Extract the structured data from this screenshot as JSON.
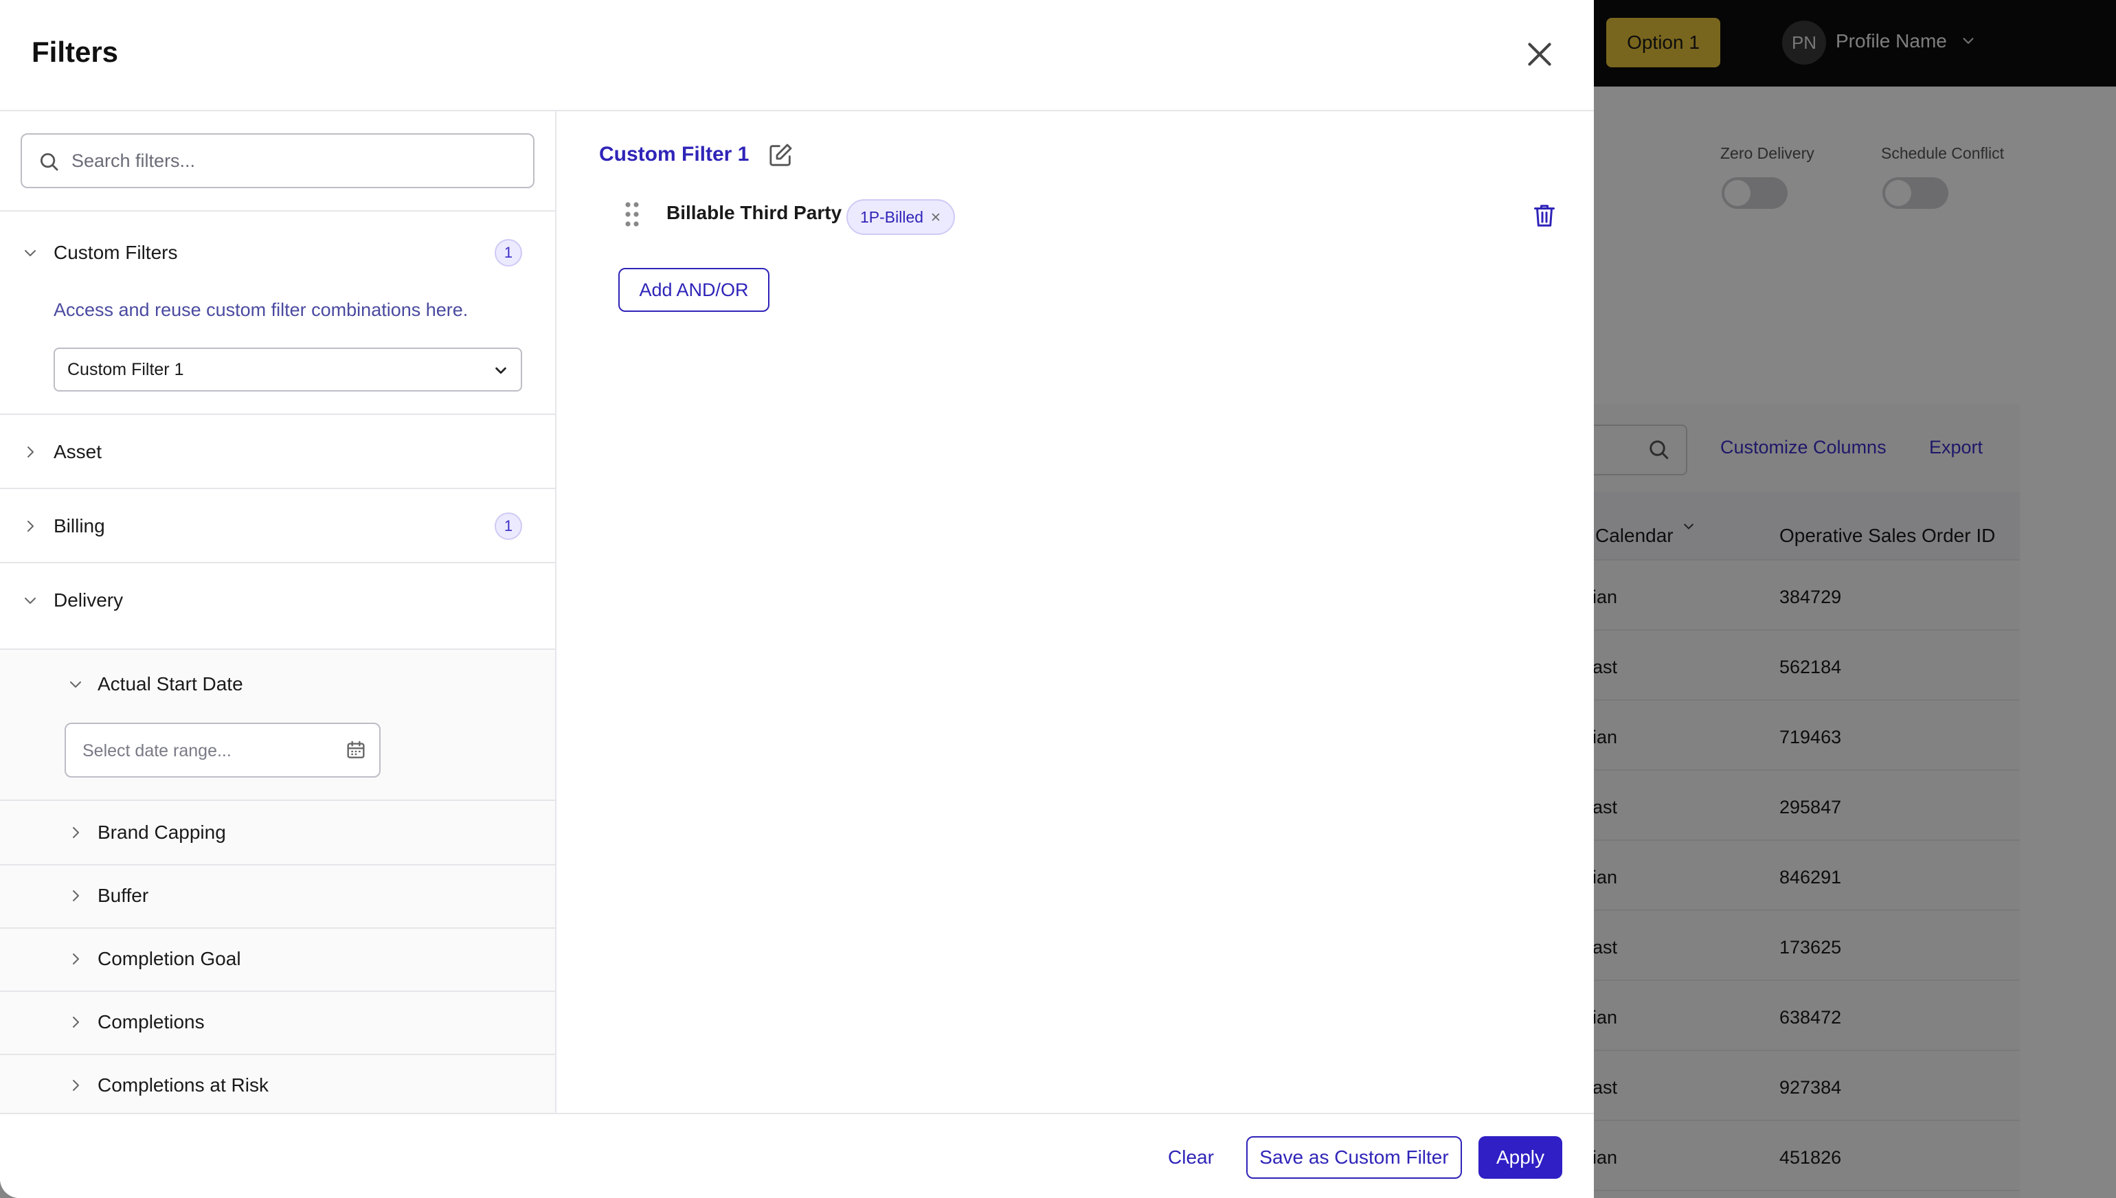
{
  "background": {
    "topbar": {
      "option_label": "Option 1",
      "avatar_initials": "PN",
      "profile_name": "Profile Name"
    },
    "toggles": [
      {
        "label": "Zero Delivery"
      },
      {
        "label": "Schedule Conflict"
      }
    ],
    "toolbar": {
      "customize_columns": "Customize Columns",
      "export": "Export"
    },
    "table": {
      "headers": [
        "Calendar",
        "Operative Sales Order ID"
      ],
      "rows": [
        {
          "calendar": "ian",
          "order_id": "384729"
        },
        {
          "calendar": "ast",
          "order_id": "562184"
        },
        {
          "calendar": "ian",
          "order_id": "719463"
        },
        {
          "calendar": "ast",
          "order_id": "295847"
        },
        {
          "calendar": "ian",
          "order_id": "846291"
        },
        {
          "calendar": "ast",
          "order_id": "173625"
        },
        {
          "calendar": "ian",
          "order_id": "638472"
        },
        {
          "calendar": "ast",
          "order_id": "927384"
        },
        {
          "calendar": "ian",
          "order_id": "451826"
        }
      ]
    }
  },
  "modal": {
    "title": "Filters",
    "search": {
      "placeholder": "Search filters..."
    },
    "sections": {
      "custom_filters": {
        "label": "Custom Filters",
        "count": "1",
        "helper": "Access and reuse custom filter combinations here.",
        "selected": "Custom Filter 1"
      },
      "asset": {
        "label": "Asset"
      },
      "billing": {
        "label": "Billing",
        "count": "1"
      },
      "delivery": {
        "label": "Delivery",
        "actual_start_date": {
          "label": "Actual Start Date",
          "placeholder": "Select date range..."
        },
        "items": [
          "Brand Capping",
          "Buffer",
          "Completion Goal",
          "Completions",
          "Completions at Risk"
        ]
      }
    },
    "right": {
      "filter_name": "Custom Filter 1",
      "rule": {
        "label": "Billable Third Party",
        "chip": "1P-Billed"
      },
      "add_button": "Add AND/OR"
    },
    "footer": {
      "clear": "Clear",
      "save": "Save as Custom Filter",
      "apply": "Apply"
    }
  },
  "colors": {
    "accent": "#2f24b8",
    "apply_bg": "#2f1fc4",
    "badge_bg": "#eceaff",
    "option_bg": "#e8c33a"
  },
  "icons": [
    "close-icon",
    "search-icon",
    "chevron-down-icon",
    "chevron-right-icon",
    "calendar-icon",
    "edit-icon",
    "drag-handle-icon",
    "trash-icon",
    "chip-remove-icon"
  ]
}
